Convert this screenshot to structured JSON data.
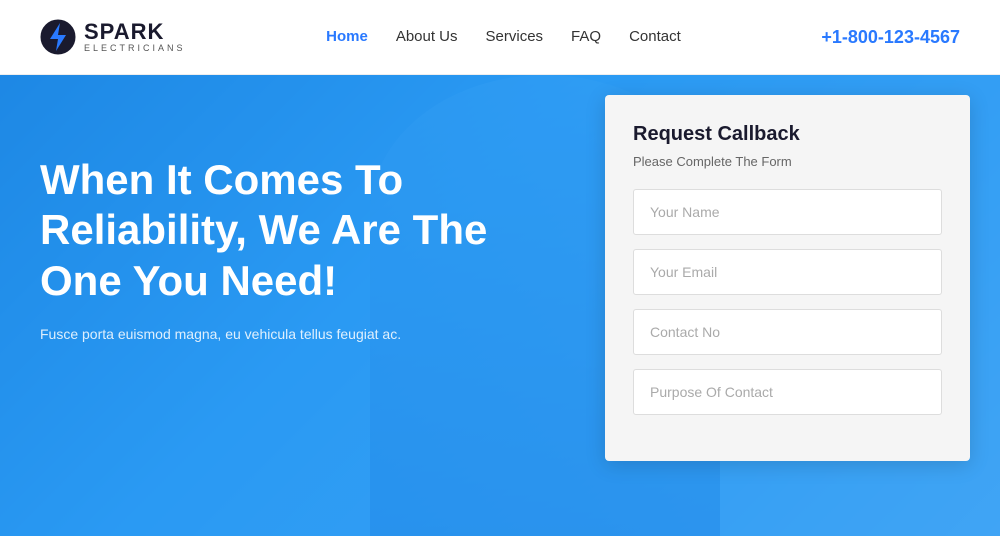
{
  "navbar": {
    "logo_name": "SPARK",
    "logo_sub": "ELECTRICIANS",
    "phone": "+1-800-123-4567",
    "nav_links": [
      {
        "label": "Home",
        "active": true
      },
      {
        "label": "About Us",
        "active": false
      },
      {
        "label": "Services",
        "active": false
      },
      {
        "label": "FAQ",
        "active": false
      },
      {
        "label": "Contact",
        "active": false
      }
    ]
  },
  "hero": {
    "headline": "When It Comes To Reliability, We Are The One You Need!",
    "subtext": "Fusce porta euismod magna, eu vehicula tellus feugiat ac."
  },
  "form": {
    "title": "Request Callback",
    "subtitle": "Please Complete The Form",
    "fields": [
      {
        "placeholder": "Your Name",
        "type": "text",
        "name": "your-name"
      },
      {
        "placeholder": "Your Email",
        "type": "email",
        "name": "your-email"
      },
      {
        "placeholder": "Contact No",
        "type": "tel",
        "name": "contact-no"
      },
      {
        "placeholder": "Purpose Of Contact",
        "type": "text",
        "name": "purpose-of-contact"
      }
    ]
  },
  "colors": {
    "accent": "#2979ff",
    "hero_bg": "#2196f3"
  }
}
